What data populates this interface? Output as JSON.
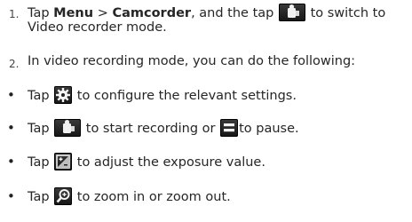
{
  "step1": {
    "number": "1.",
    "tap": "Tap",
    "menu": "Menu",
    "sep": ">",
    "camcorder": "Camcorder",
    "and_the_tap": ", and the tap",
    "to_switch_to": "to switch to",
    "line2": "Video recorder mode."
  },
  "step2": {
    "number": "2.",
    "text": "In video recording mode, you can do the following:"
  },
  "bullets": [
    {
      "tap": "Tap",
      "icon": "settings-gear-icon",
      "text": "to configure the relevant settings."
    },
    {
      "tap": "Tap",
      "icon": "record-camera-icon",
      "text_mid": "to start recording or",
      "icon2": "pause-icon",
      "text": "to pause."
    },
    {
      "tap": "Tap",
      "icon": "exposure-icon",
      "text": "to adjust the exposure value."
    },
    {
      "tap": "Tap",
      "icon": "zoom-icon",
      "text": "to zoom in or zoom out."
    }
  ],
  "bullet_glyph": "•"
}
